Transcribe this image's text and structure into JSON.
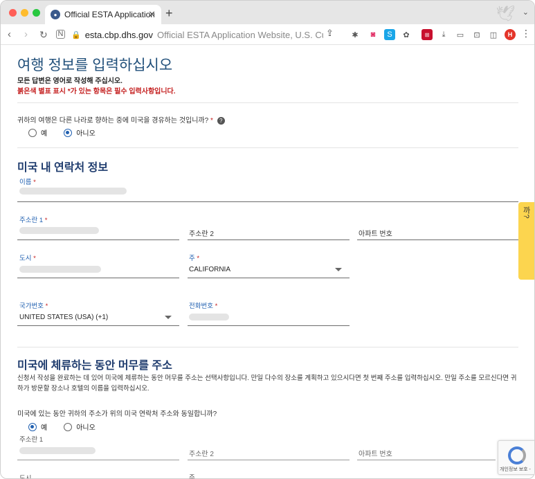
{
  "browser": {
    "tab_title": "Official ESTA Application Website",
    "tab_close": "✕",
    "new_tab": "+",
    "url_domain": "esta.cbp.dhs.gov",
    "url_page_title": "Official ESTA Application Website, U.S. Customs",
    "profile_initial": "H"
  },
  "page": {
    "title": "여행 정보를 입력하십시오",
    "note_english": "모든 답변은 영어로 작성해 주십시오.",
    "note_required": "붉은색 별표 표시 *가 있는 항목은 필수 입력사항입니다.",
    "transit_question": "귀하의 여행은 다른 나라로 향하는 중에 미국을 경유하는 것입니까?",
    "required_mark": "*",
    "transit_yes": "예",
    "transit_no": "아니오",
    "transit_selected": "no",
    "us_contact": {
      "heading": "미국 내 연락처 정보",
      "name_label": "이름",
      "address1_label": "주소란 1",
      "address2_placeholder": "주소란 2",
      "apt_placeholder": "아파트 번호",
      "city_label": "도시",
      "state_label": "주",
      "state_value": "CALIFORNIA",
      "country_code_label": "국가번호",
      "country_code_value": "UNITED STATES (USA) (+1)",
      "phone_label": "전화번호"
    },
    "us_stay": {
      "heading": "미국에 체류하는 동안 머무를 주소",
      "description": "신청서 작성을 완료하는 데 있어 미국에 체류하는 동안 머무를 주소는 선택사항입니다. 만일 다수의 장소를 계획하고 있으시다면 첫 번째 주소를 입력하십시오. 만일 주소를 모르신다면 귀하가 방문할 장소나 호텔의 이름을 입력하십시오.",
      "same_question": "미국에 있는 동안 귀하의 주소가 위의 미국 연락처 주소와 동일합니까?",
      "same_yes": "예",
      "same_no": "아니오",
      "same_selected": "yes",
      "address1_label": "주소란 1",
      "address2_placeholder": "주소란 2",
      "apt_placeholder": "아파트 번호",
      "city_label": "도시",
      "state_label": "주"
    },
    "help_tab": "도움이 필요하십니까?",
    "recaptcha_text": "개인정보 보호 -"
  },
  "colors": {
    "heading_blue": "#1f4e79",
    "label_blue": "#1f5fb0",
    "required_red": "#c41e1e",
    "help_yellow": "#fcd54f"
  },
  "icons": [
    "back-icon",
    "forward-icon",
    "reload-icon",
    "reader-icon",
    "lock-icon",
    "share-icon",
    "help-icon",
    "recaptcha-icon"
  ]
}
